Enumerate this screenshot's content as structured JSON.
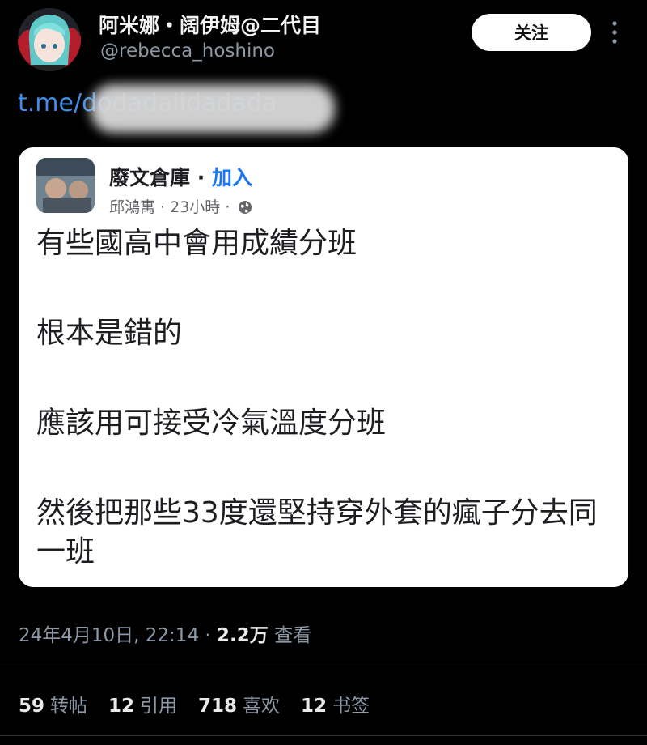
{
  "author": {
    "display_name": "阿米娜・阔伊姆@二代目",
    "handle": "@rebecca_hoshino",
    "follow_label": "关注"
  },
  "tweet": {
    "link_text": "t.me/dodadalidadada"
  },
  "embed": {
    "group_name": "廢文倉庫",
    "separator": " · ",
    "join_label": "加入",
    "poster_line": "邱鴻寓 · 23小時 ·",
    "paragraphs": [
      "有些國高中會用成績分班",
      "根本是錯的",
      "應該用可接受冷氣溫度分班",
      "然後把那些33度還堅持穿外套的瘋子分去同一班"
    ]
  },
  "meta": {
    "timestamp": "24年4月10日, 22:14 · ",
    "views": "2.2万",
    "views_label": " 查看"
  },
  "stats": [
    {
      "count": "59",
      "label": "转帖"
    },
    {
      "count": "12",
      "label": "引用"
    },
    {
      "count": "718",
      "label": "喜欢"
    },
    {
      "count": "12",
      "label": "书签"
    }
  ],
  "colors": {
    "background": "#000000",
    "link": "#3f8ee8",
    "join": "#1877f2",
    "muted": "#8b98a5"
  }
}
